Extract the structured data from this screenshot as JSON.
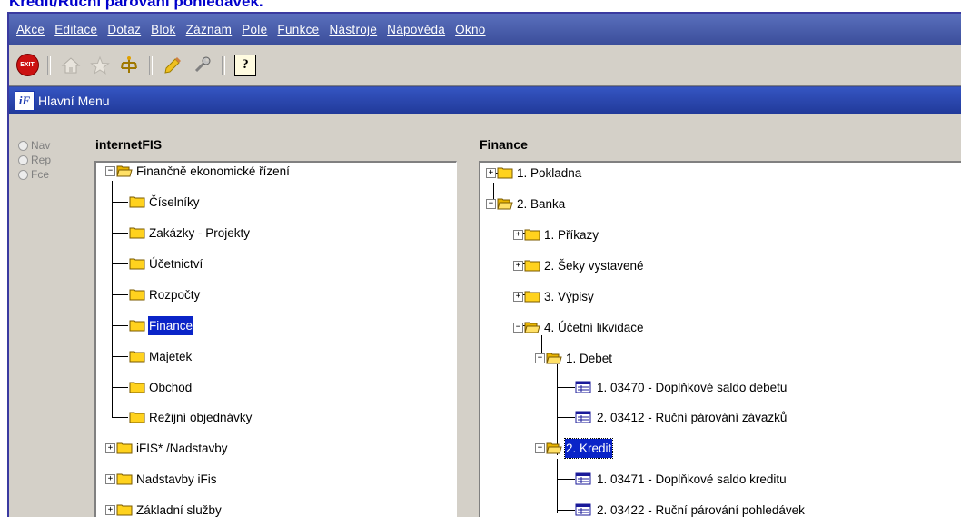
{
  "doc_title": "Kredit/Ruční párování pohledávek.",
  "menubar": {
    "items": [
      "Akce",
      "Editace",
      "Dotaz",
      "Blok",
      "Záznam",
      "Pole",
      "Funkce",
      "Nástroje",
      "Nápověda",
      "Okno"
    ]
  },
  "toolbar": {
    "exit_label": "EXIT",
    "help_label": "?"
  },
  "window": {
    "title": "Hlavní Menu",
    "logo_text": "iF"
  },
  "mode_options": [
    "Nav",
    "Rep",
    "Fce"
  ],
  "left_panel": {
    "title": "internetFIS",
    "items": [
      "Finančně ekonomické řízení",
      "Číselníky",
      "Zakázky - Projekty",
      "Účetnictví",
      "Rozpočty",
      "Finance",
      "Majetek",
      "Obchod",
      "Režijní objednávky",
      "iFIS* /Nadstavby",
      "Nadstavby iFis",
      "Základní služby"
    ],
    "selected": "Finance"
  },
  "right_panel": {
    "title": "Finance",
    "items": [
      "1. Pokladna",
      "2. Banka",
      "1. Příkazy",
      "2. Šeky vystavené",
      "3. Výpisy",
      "4. Účetní likvidace",
      "1. Debet",
      "1. 03470 - Doplňkové saldo debetu",
      "2. 03412 - Ruční párování závazků",
      "2. Kredit",
      "1. 03471 - Doplňkové saldo kreditu",
      "2. 03422 - Ruční párování pohledávek"
    ],
    "selected": "2. Kredit"
  },
  "colors": {
    "menubar": "#3b4e9b",
    "titlebar": "#213a9a",
    "selection": "#0a24c8",
    "background": "#d4d0c8",
    "doc_title": "#0000cc"
  }
}
